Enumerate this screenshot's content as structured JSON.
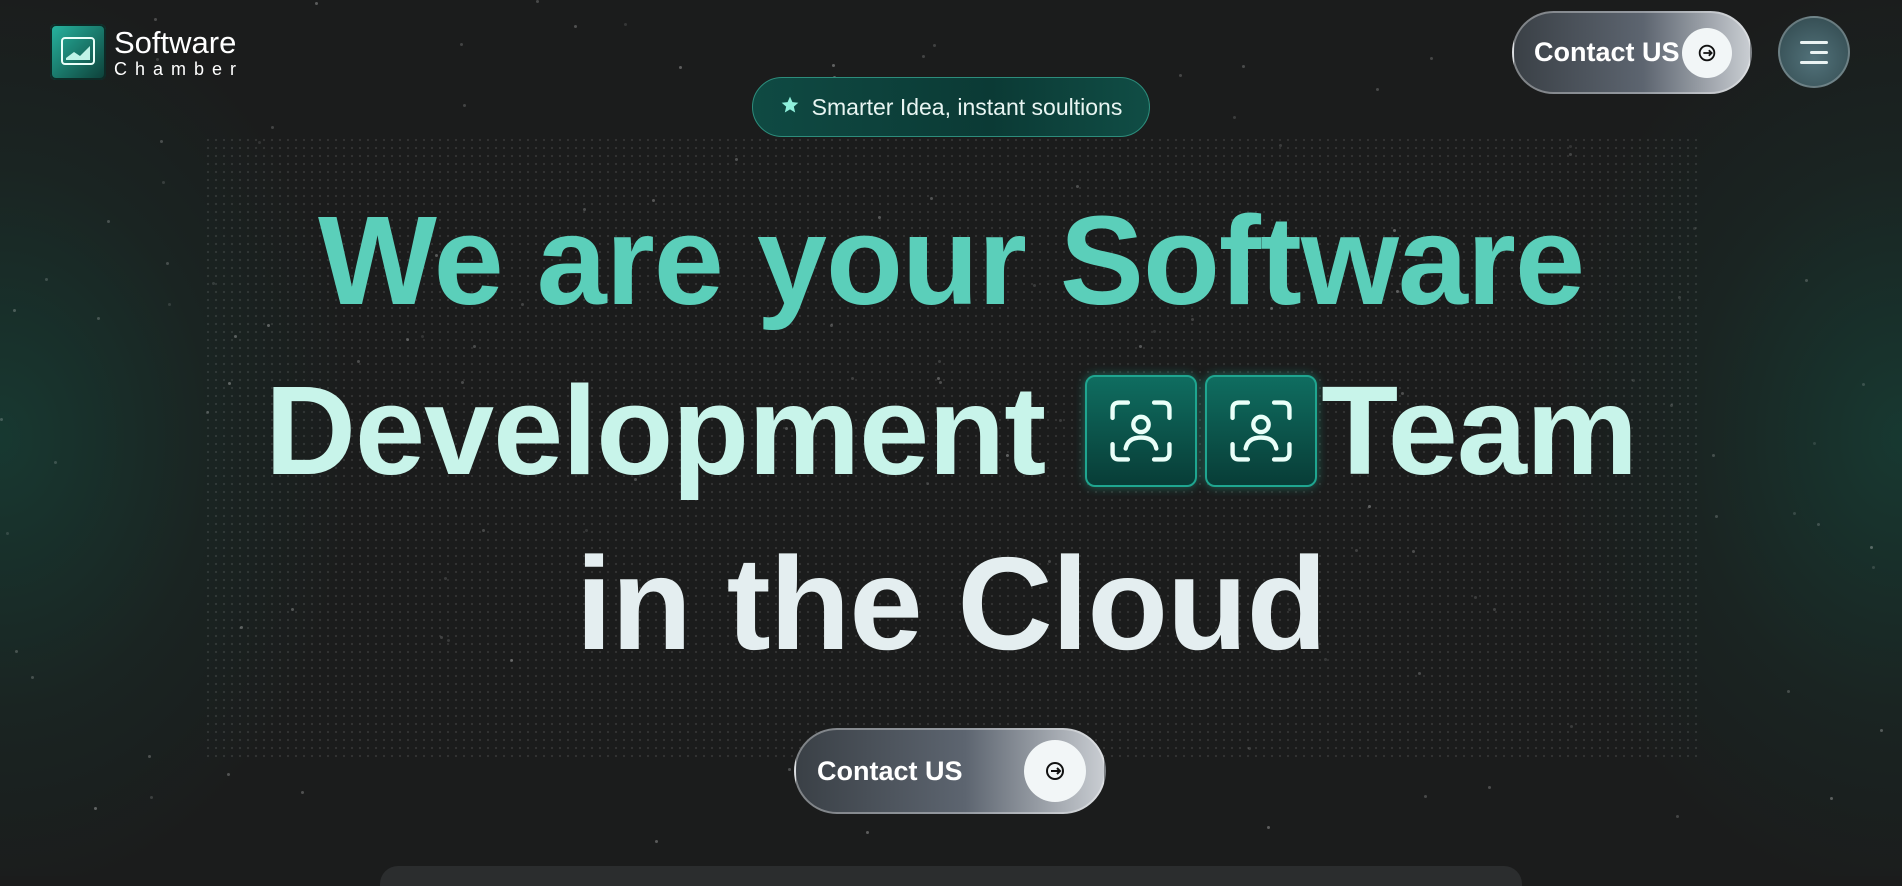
{
  "header": {
    "logo_title": "Software",
    "logo_subtitle": "Chamber",
    "contact_label": "Contact US",
    "menu_icon": "hamburger-menu-icon"
  },
  "hero": {
    "badge_text": "Smarter Idea, instant soultions",
    "line1": "We are your Software",
    "line2_left": "Development",
    "line2_right": "Team",
    "line3": "in the Cloud",
    "cta_label": "Contact US"
  },
  "colors": {
    "background": "#1b1c1c",
    "accent_teal": "#5bcfba",
    "mint": "#c8f4ea",
    "pale": "#e4eef0"
  },
  "icons": [
    "star-icon",
    "face-scan-icon",
    "arrow-in-circle-icon"
  ]
}
